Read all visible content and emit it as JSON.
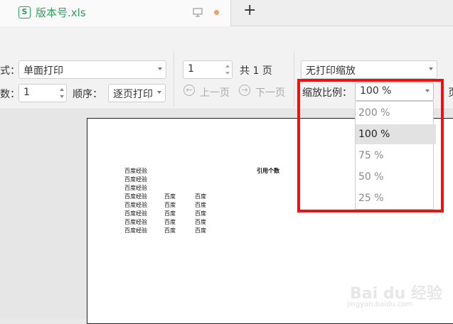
{
  "tab": {
    "icon_letter": "S",
    "title": "版本号.xls",
    "new_tab": "+"
  },
  "toolbar": {
    "mode_label": "式：",
    "mode_value": "单面打印",
    "copies_label": "数：",
    "copies_value": "1",
    "order_label": "顺序：",
    "order_value": "逐页打印",
    "page_value": "1",
    "total_pages": "共 1 页",
    "prev_page": "上一页",
    "next_page": "下一页",
    "scale_mode_value": "无打印缩放",
    "zoom_label": "缩放比例：",
    "zoom_value": "100 %",
    "right_cut": "页"
  },
  "zoom_options": [
    "200 %",
    "100 %",
    "75 %",
    "50 %",
    "25 %"
  ],
  "zoom_selected": "100 %",
  "sheet": {
    "header": "引用个数",
    "col1": [
      "百度经验",
      "百度经验",
      "百度经验",
      "百度经验",
      "百度经验",
      "百度经验",
      "百度经验",
      "百度经验"
    ],
    "col2": [
      "百度",
      "百度",
      "百度",
      "百度",
      "百度"
    ],
    "col3": [
      "百度",
      "百度",
      "百度",
      "百度",
      "百度"
    ]
  },
  "watermark": {
    "brand": "Bai du 经验",
    "url": "jingyan.baidu.com"
  },
  "colors": {
    "highlight": "#ee1111",
    "tab_green": "#2e9e5b"
  }
}
